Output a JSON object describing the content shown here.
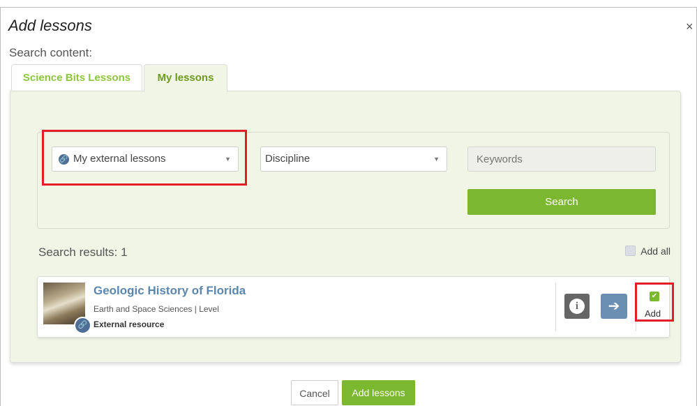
{
  "modal": {
    "title": "Add lessons",
    "close_label": "×",
    "search_label": "Search content:"
  },
  "tabs": [
    {
      "label": "Science Bits Lessons",
      "active": false
    },
    {
      "label": "My lessons",
      "active": true
    }
  ],
  "filters": {
    "source_select": {
      "value": "My external lessons",
      "icon": "link-icon"
    },
    "discipline_select": {
      "value": "Discipline"
    },
    "keywords": {
      "placeholder": "Keywords"
    },
    "search_button": "Search"
  },
  "results": {
    "summary": "Search results: 1",
    "add_all_label": "Add all",
    "items": [
      {
        "title": "Geologic History of Florida",
        "subtitle": "Earth and Space Sciences | Level",
        "type": "External resource",
        "add_label": "Add",
        "checked": true
      }
    ]
  },
  "footer": {
    "cancel": "Cancel",
    "add_lessons": "Add lessons"
  },
  "colors": {
    "accent_green": "#7cb82f",
    "highlight_red": "#e41e26",
    "link_blue": "#5b86ad"
  }
}
